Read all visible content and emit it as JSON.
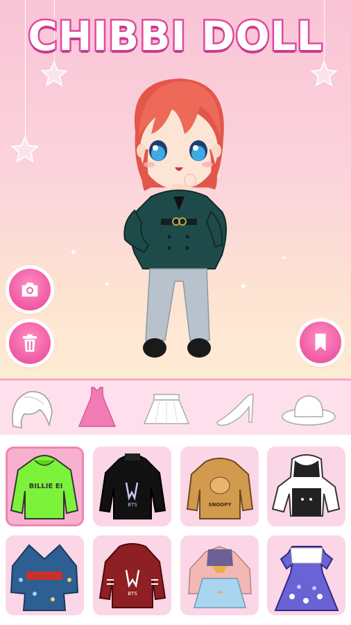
{
  "app": {
    "title": "CHIBBI DOLL",
    "accent_color": "#ef5aa3",
    "background_gradient": [
      "#f9c4d6",
      "#feecd4"
    ]
  },
  "side_buttons": [
    {
      "name": "camera-button",
      "icon": "camera-icon"
    },
    {
      "name": "trash-button",
      "icon": "trash-icon"
    },
    {
      "name": "bookmark-button",
      "icon": "bookmark-icon"
    }
  ],
  "categories": [
    {
      "icon": "hair-icon",
      "selected": false
    },
    {
      "icon": "dress-icon",
      "selected": true
    },
    {
      "icon": "skirt-icon",
      "selected": false
    },
    {
      "icon": "high-heel-icon",
      "selected": false
    },
    {
      "icon": "hat-icon",
      "selected": false
    }
  ],
  "items": [
    {
      "icon": "green-hoodie-icon",
      "selected": true,
      "print": "BILLIE EI"
    },
    {
      "icon": "black-bts-sweatshirt-icon",
      "selected": false,
      "print": "BTS"
    },
    {
      "icon": "tan-snoopy-sweater-icon",
      "selected": false,
      "print": "SNOOPY"
    },
    {
      "icon": "black-white-cat-hoodie-icon",
      "selected": false
    },
    {
      "icon": "blue-kimono-icon",
      "selected": false
    },
    {
      "icon": "red-bts-hoodie-icon",
      "selected": false,
      "print": "BTS"
    },
    {
      "icon": "pastel-moon-outfit-icon",
      "selected": false
    },
    {
      "icon": "purple-floral-dress-icon",
      "selected": false
    }
  ]
}
